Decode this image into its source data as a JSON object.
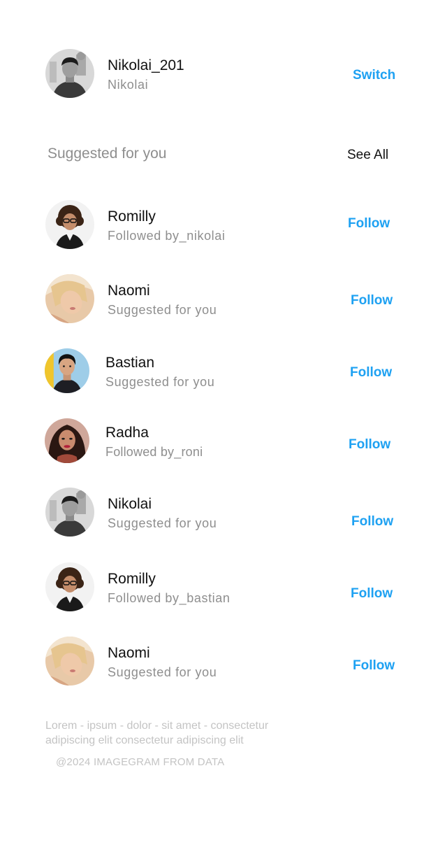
{
  "current_user": {
    "username": "Nikolai_201",
    "display_name": "Nikolai",
    "switch_label": "Switch",
    "avatar_icon": "avatar-bw-man-icon"
  },
  "suggestions": {
    "title": "Suggested for you",
    "see_all_label": "See All",
    "items": [
      {
        "name": "Romilly",
        "subtitle": "Followed by_nikolai",
        "action": "Follow",
        "avatar_icon": "avatar-curly-woman-icon"
      },
      {
        "name": "Naomi",
        "subtitle": "Suggested for you",
        "action": "Follow",
        "avatar_icon": "avatar-blonde-woman-icon"
      },
      {
        "name": "Bastian",
        "subtitle": "Suggested for you",
        "action": "Follow",
        "avatar_icon": "avatar-dark-hair-man-icon"
      },
      {
        "name": "Radha",
        "subtitle": "Followed by_roni",
        "action": "Follow",
        "avatar_icon": "avatar-dark-hair-woman-icon"
      },
      {
        "name": "Nikolai",
        "subtitle": "Suggested for you",
        "action": "Follow",
        "avatar_icon": "avatar-bw-man-icon"
      },
      {
        "name": "Romilly",
        "subtitle": "Followed by_bastian",
        "action": "Follow",
        "avatar_icon": "avatar-curly-woman-icon"
      },
      {
        "name": "Naomi",
        "subtitle": "Suggested for you",
        "action": "Follow",
        "avatar_icon": "avatar-blonde-woman-icon"
      }
    ]
  },
  "footer": {
    "links": "Lorem - ipsum - dolor - sit amet - consectetur adipiscing elit consectetur adipiscing elit",
    "copyright": "@2024 IMAGEGRAM FROM DATA"
  },
  "colors": {
    "accent": "#1ea1f2",
    "muted_text": "#8e8e8e",
    "footer_text": "#c4c4c4"
  }
}
